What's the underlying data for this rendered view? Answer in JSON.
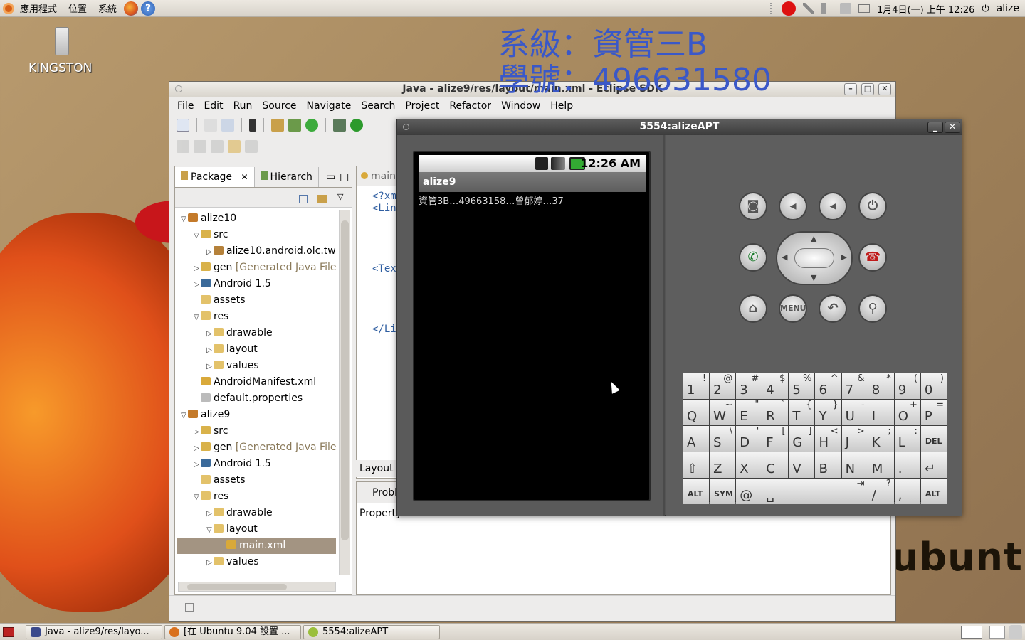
{
  "top_panel": {
    "menus": [
      "應用程式",
      "位置",
      "系統"
    ],
    "clock": "1月4日(一) 上午 12:26",
    "user": "alize"
  },
  "desktop": {
    "icon_label": "KINGSTON",
    "overlay_line1": "系級：資管三B",
    "overlay_line2": "學號：496631580",
    "wallpaper_text": "ubuntu"
  },
  "eclipse": {
    "title": "Java - alize9/res/layout/main.xml - Eclipse SDK",
    "menus": [
      "File",
      "Edit",
      "Run",
      "Source",
      "Navigate",
      "Search",
      "Project",
      "Refactor",
      "Window",
      "Help"
    ],
    "package_tab": "Package",
    "hierarchy_tab": "Hierarch",
    "editor_tab": "main",
    "code_lines": [
      "<?xm",
      "<Lin",
      "<Tex",
      "</Li"
    ],
    "layout_tab": "Layout",
    "problems_tab": "Probl",
    "properties_label": "Property",
    "tree": [
      {
        "label": "alize10",
        "indent": 0,
        "arrow": "▽",
        "icon": "project",
        "suffix": ""
      },
      {
        "label": "src",
        "indent": 1,
        "arrow": "▽",
        "icon": "pkgfolder",
        "suffix": ""
      },
      {
        "label": "alize10.android.olc.tw",
        "indent": 2,
        "arrow": "▷",
        "icon": "package",
        "suffix": ""
      },
      {
        "label": "gen",
        "indent": 1,
        "arrow": "▷",
        "icon": "pkgfolder",
        "suffix": " [Generated Java Files"
      },
      {
        "label": "Android 1.5",
        "indent": 1,
        "arrow": "▷",
        "icon": "library",
        "suffix": ""
      },
      {
        "label": "assets",
        "indent": 1,
        "arrow": "",
        "icon": "folder",
        "suffix": ""
      },
      {
        "label": "res",
        "indent": 1,
        "arrow": "▽",
        "icon": "folder",
        "suffix": ""
      },
      {
        "label": "drawable",
        "indent": 2,
        "arrow": "▷",
        "icon": "folder",
        "suffix": ""
      },
      {
        "label": "layout",
        "indent": 2,
        "arrow": "▷",
        "icon": "folder",
        "suffix": ""
      },
      {
        "label": "values",
        "indent": 2,
        "arrow": "▷",
        "icon": "folder",
        "suffix": ""
      },
      {
        "label": "AndroidManifest.xml",
        "indent": 1,
        "arrow": "",
        "icon": "xmlfile",
        "suffix": ""
      },
      {
        "label": "default.properties",
        "indent": 1,
        "arrow": "",
        "icon": "file",
        "suffix": ""
      },
      {
        "label": "alize9",
        "indent": 0,
        "arrow": "▽",
        "icon": "project",
        "suffix": ""
      },
      {
        "label": "src",
        "indent": 1,
        "arrow": "▷",
        "icon": "pkgfolder",
        "suffix": ""
      },
      {
        "label": "gen",
        "indent": 1,
        "arrow": "▷",
        "icon": "pkgfolder",
        "suffix": " [Generated Java Files"
      },
      {
        "label": "Android 1.5",
        "indent": 1,
        "arrow": "▷",
        "icon": "library",
        "suffix": ""
      },
      {
        "label": "assets",
        "indent": 1,
        "arrow": "",
        "icon": "folder",
        "suffix": ""
      },
      {
        "label": "res",
        "indent": 1,
        "arrow": "▽",
        "icon": "folder",
        "suffix": ""
      },
      {
        "label": "drawable",
        "indent": 2,
        "arrow": "▷",
        "icon": "folder",
        "suffix": ""
      },
      {
        "label": "layout",
        "indent": 2,
        "arrow": "▽",
        "icon": "folder",
        "suffix": ""
      },
      {
        "label": "main.xml",
        "indent": 3,
        "arrow": "",
        "icon": "xmlfile",
        "suffix": "",
        "selected": true
      },
      {
        "label": "values",
        "indent": 2,
        "arrow": "▷",
        "icon": "folder",
        "suffix": ""
      }
    ]
  },
  "emulator": {
    "title": "5554:alizeAPT",
    "clock": "12:26 AM",
    "app_title": "alize9",
    "app_text": "資管3B…49663158…曾郁婷…37",
    "menu_key": "MENU",
    "keyboard": [
      [
        "1",
        "!"
      ],
      [
        "2",
        "@"
      ],
      [
        "3",
        "#"
      ],
      [
        "4",
        "$"
      ],
      [
        "5",
        "%"
      ],
      [
        "6",
        "^"
      ],
      [
        "7",
        "&"
      ],
      [
        "8",
        "*"
      ],
      [
        "9",
        "("
      ],
      [
        "0",
        ")"
      ],
      [
        "Q",
        ""
      ],
      [
        "W",
        "~"
      ],
      [
        "E",
        "\""
      ],
      [
        "R",
        "`"
      ],
      [
        "T",
        "{"
      ],
      [
        "Y",
        "}"
      ],
      [
        "U",
        "-"
      ],
      [
        "I",
        ""
      ],
      [
        "O",
        "+"
      ],
      [
        "P",
        "="
      ],
      [
        "A",
        ""
      ],
      [
        "S",
        "\\"
      ],
      [
        "D",
        "'"
      ],
      [
        "F",
        "["
      ],
      [
        "G",
        "]"
      ],
      [
        "H",
        "<"
      ],
      [
        "J",
        ">"
      ],
      [
        "K",
        ";"
      ],
      [
        "L",
        ":"
      ],
      [
        "DEL",
        ""
      ],
      [
        "⇧",
        ""
      ],
      [
        "Z",
        ""
      ],
      [
        "X",
        ""
      ],
      [
        "C",
        ""
      ],
      [
        "V",
        ""
      ],
      [
        "B",
        ""
      ],
      [
        "N",
        ""
      ],
      [
        "M",
        ""
      ],
      [
        ".",
        ""
      ],
      [
        "↵",
        ""
      ],
      [
        "ALT",
        ""
      ],
      [
        "SYM",
        ""
      ],
      [
        "@",
        ""
      ],
      [
        "␣",
        "⇥"
      ],
      [
        "/",
        "?"
      ],
      [
        ",",
        ""
      ],
      [
        "ALT",
        ""
      ]
    ]
  },
  "taskbar": {
    "tasks": [
      "Java - alize9/res/layo...",
      "[在 Ubuntu 9.04 設置 ...",
      "5554:alizeAPT"
    ]
  }
}
